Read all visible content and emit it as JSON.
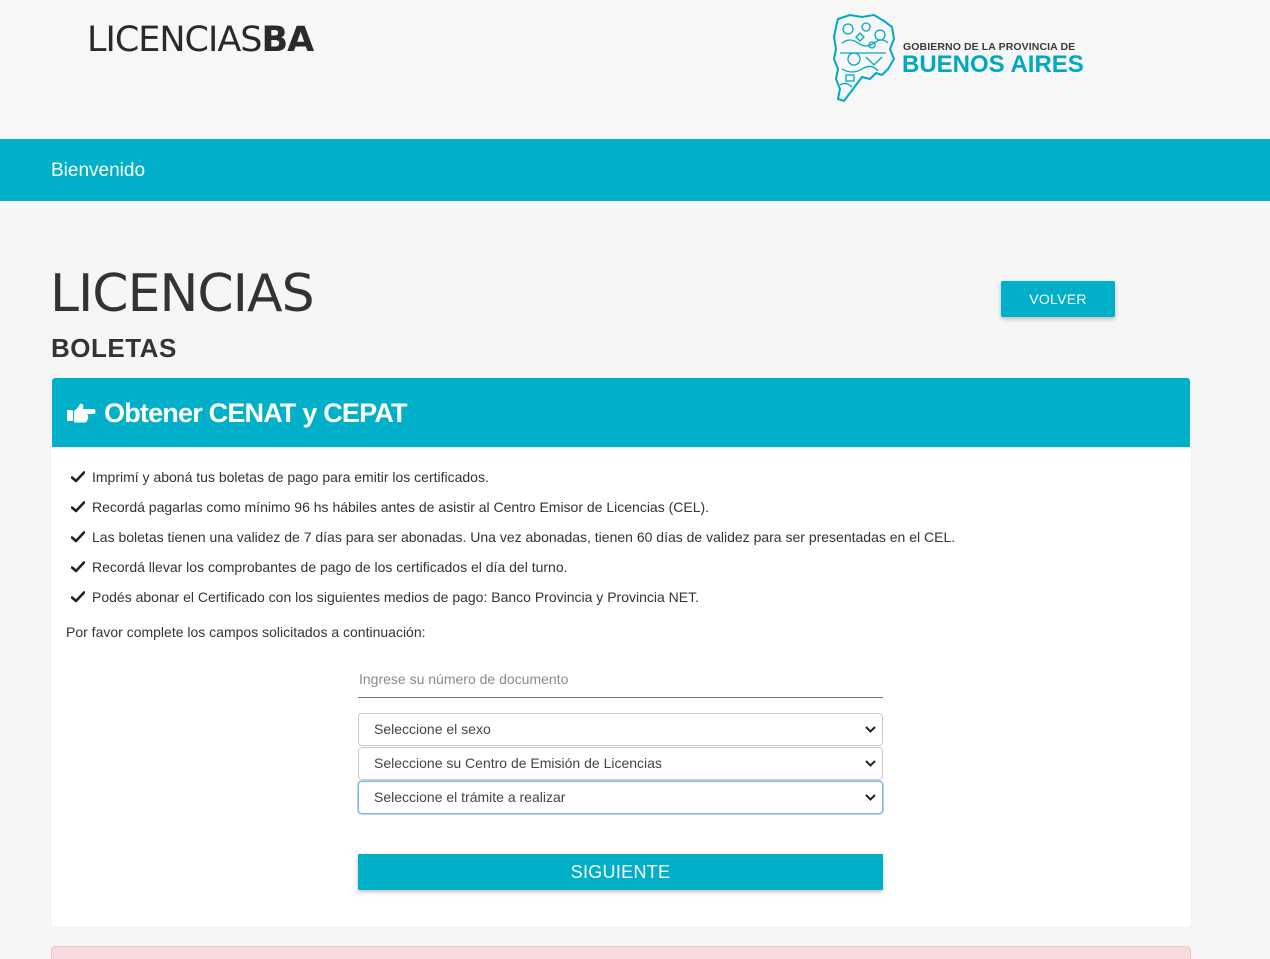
{
  "header": {
    "brand_light": "LICENCIAS",
    "brand_bold": "BA",
    "gov_top": "GOBIERNO DE LA PROVINCIA DE",
    "gov_main": "BUENOS AIRES"
  },
  "nav": {
    "welcome": "Bienvenido"
  },
  "page": {
    "title": "LICENCIAS",
    "subtitle": "BOLETAS",
    "back_label": "VOLVER"
  },
  "card": {
    "title": "Obtener CENAT y CEPAT",
    "items": [
      "Imprimí y aboná tus boletas de pago para emitir los certificados.",
      "Recordá pagarlas como mínimo 96 hs hábiles antes de asistir al Centro Emisor de Licencias (CEL).",
      "Las boletas tienen una validez de 7 días para ser abonadas. Una vez abonadas, tienen 60 días de validez para ser presentadas en el CEL.",
      "Recordá llevar los comprobantes de pago de los certificados el día del turno.",
      "Podés abonar el Certificado con los siguientes medios de pago: Banco Provincia y Provincia NET."
    ],
    "instructions": "Por favor complete los campos solicitados a continuación:"
  },
  "form": {
    "document_placeholder": "Ingrese su número de documento",
    "sex_select": "Seleccione el sexo",
    "center_select": "Seleccione su Centro de Emisión de Licencias",
    "procedure_select": "Seleccione el trámite a realizar",
    "next_label": "SIGUIENTE"
  },
  "colors": {
    "accent": "#00b0c8",
    "logo_blue": "#00a8c6",
    "alert_bg": "#f8dcdd"
  },
  "icons": {
    "card_header": "hand-pointing-right-icon",
    "list_item": "check-icon",
    "select": "chevron-down-icon"
  }
}
